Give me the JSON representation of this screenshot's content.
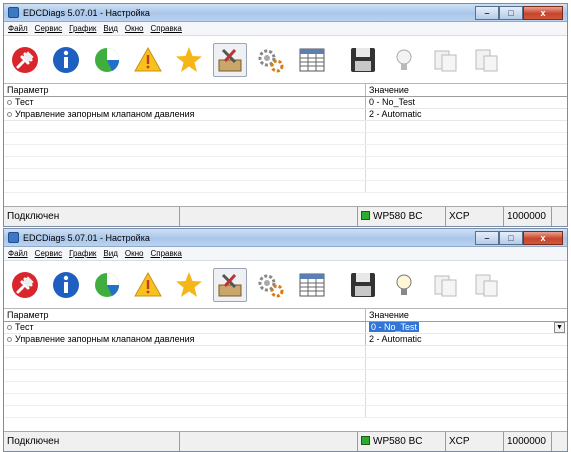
{
  "window_title": "EDCDiags 5.07.01 - Настройка",
  "caption_buttons": {
    "minimize": "–",
    "maximize": "□",
    "close": "x"
  },
  "menu": [
    "Файл",
    "Сервис",
    "График",
    "Вид",
    "Окно",
    "Справка"
  ],
  "toolbar_icons": [
    "disconnect-plug-icon",
    "info-icon",
    "pie-chart-icon",
    "warning-icon",
    "star-icon",
    "tools-icon",
    "gears-icon",
    "table-icon",
    "save-icon",
    "lightbulb-icon",
    "copy-disabled-icon",
    "paste-disabled-icon"
  ],
  "grid": {
    "headers": {
      "param": "Параметр",
      "value": "Значение"
    }
  },
  "screen1": {
    "rows": [
      {
        "param": "Тест",
        "value": "0 - No_Test"
      },
      {
        "param": "Управление запорным клапаном давления",
        "value": "2 - Automatic"
      }
    ]
  },
  "screen2": {
    "rows": [
      {
        "param": "Тест",
        "value": "0 - No_Test",
        "editing": true
      },
      {
        "param": "Управление запорным клапаном давления",
        "value": "2 - Automatic"
      }
    ]
  },
  "status": {
    "connection": "Подключен",
    "device": "WP580 BC",
    "protocol": "XCP",
    "baud": "1000000"
  },
  "colors": {
    "selection": "#3175d6",
    "status_led": "#2eaa2e"
  }
}
